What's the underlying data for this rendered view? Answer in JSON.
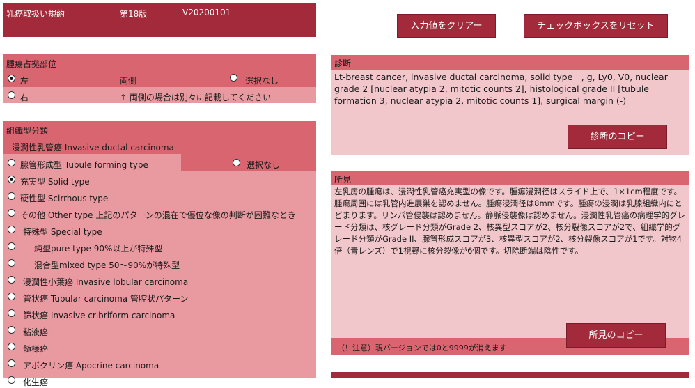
{
  "header": {
    "title": "乳癌取扱い規約",
    "edition": "第18版",
    "version": "V20200101"
  },
  "buttons": {
    "clear": "入力値をクリアー",
    "reset": "チェックボックスをリセット",
    "copy_diag": "診断のコピー",
    "copy_find": "所見のコピー"
  },
  "location": {
    "title": "腫瘍占拠部位",
    "left": "左",
    "right": "右",
    "both": "両側",
    "none": "選択なし",
    "note": "↑ 両側の場合は別々に記載してください",
    "selected": "左"
  },
  "histology": {
    "title": "組織型分類",
    "group": "浸潤性乳管癌 Invasive ductal carcinoma",
    "none": "選択なし",
    "items": [
      {
        "label": "腺管形成型 Tubule forming type",
        "checked": false
      },
      {
        "label": "充実型 Solid type",
        "checked": true
      },
      {
        "label": "硬性型 Scirrhous type",
        "checked": false
      },
      {
        "label": "その他 Other type 上記のパターンの混在で優位な像の判断が困難なとき",
        "checked": false
      },
      {
        "label": "特殊型 Special type",
        "checked": false
      },
      {
        "label": "純型pure type 90%以上が特殊型",
        "checked": false
      },
      {
        "label": "混合型mixed type 50～90%が特殊型",
        "checked": false
      },
      {
        "label": "浸潤性小葉癌 Invasive lobular carcinoma",
        "checked": false
      },
      {
        "label": "管状癌 Tubular carcinoma 管腔状パターン",
        "checked": false
      },
      {
        "label": "篩状癌 Invasive cribriform carcinoma",
        "checked": false
      },
      {
        "label": "粘液癌",
        "checked": false
      },
      {
        "label": "髄様癌",
        "checked": false
      },
      {
        "label": "アポクリン癌 Apocrine carcinoma",
        "checked": false
      },
      {
        "label": "化生癌",
        "checked": false
      }
    ]
  },
  "diagnosis": {
    "title": "診断",
    "text": "Lt-breast cancer, invasive ductal carcinoma, solid type　, g, Ly0, V0, nuclear grade 2 [nuclear atypia 2, mitotic counts 2], histological grade II [tubule formation 3, nuclear atypia 2, mitotic counts 1], surgical margin (-)"
  },
  "findings": {
    "title": "所見",
    "text": "左乳房の腫瘍は、浸潤性乳管癌充実型の像です。腫瘍浸潤径はスライド上で、1×1cm程度です。腫瘍周囲には乳管内進展巣を認めません。腫瘍浸潤径は8mmです。腫瘍の浸潤は乳腺組織内にとどまります。リンパ管侵襲は認めません。静脈侵襲像は認めません。浸潤性乳管癌の病理学的グレード分類は、核グレード分類がGrade 2、核異型スコアが2、核分裂像スコアが2で、組織学的グレード分類がGrade II、腺管形成スコアが3、核異型スコアが2、核分裂像スコアが1です。対物4倍（青レンズ）で1視野に核分裂像が6個です。切除断端は陰性です。",
    "note": "（！注意）現バージョンでは0と9999が消えます"
  }
}
